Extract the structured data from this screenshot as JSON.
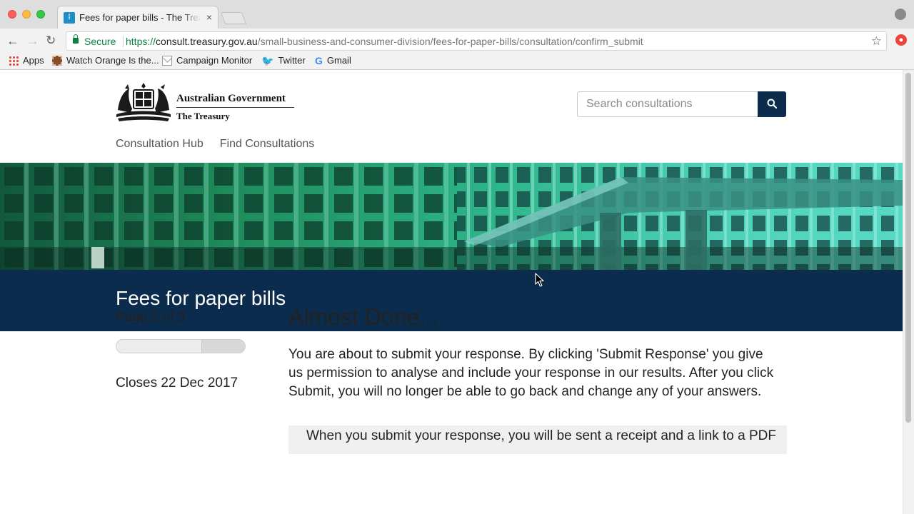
{
  "browser": {
    "tab_title": "Fees for paper bills - The Treasury",
    "tab_close": "×",
    "secure_label": "Secure",
    "url_scheme": "https://",
    "url_host": "consult.treasury.gov.au",
    "url_path": "/small-business-and-consumer-division/fees-for-paper-bills/consultation/confirm_submit",
    "bookmarks": [
      {
        "label": "Apps",
        "icon": "apps-icon"
      },
      {
        "label": "Watch Orange Is the...",
        "icon": "film-icon"
      },
      {
        "label": "Campaign Monitor",
        "icon": "mail-icon"
      },
      {
        "label": "Twitter",
        "icon": "twitter-icon"
      },
      {
        "label": "Gmail",
        "icon": "google-icon"
      }
    ]
  },
  "header": {
    "logo_line1": "Australian Government",
    "logo_line2": "The Treasury",
    "search_placeholder": "Search consultations",
    "nav": [
      "Consultation Hub",
      "Find Consultations"
    ]
  },
  "consultation": {
    "title": "Fees for paper bills"
  },
  "sidebar": {
    "page_indicator": "Page 2 of 3",
    "progress_percent": 66.7,
    "closing_date": "Closes 22 Dec 2017"
  },
  "main": {
    "heading": "Almost Done...",
    "intro": "You are about to submit your response. By clicking 'Submit Response' you give us permission to analyse and include your response in our results. After you click Submit, you will no longer be able to go back and change any of your answers.",
    "notice": "When you submit your response, you will be sent a receipt and a link to a PDF"
  },
  "colors": {
    "brand_navy": "#0b2c4c",
    "secure_green": "#0b8043",
    "hero_teal": "#2fb58a"
  }
}
